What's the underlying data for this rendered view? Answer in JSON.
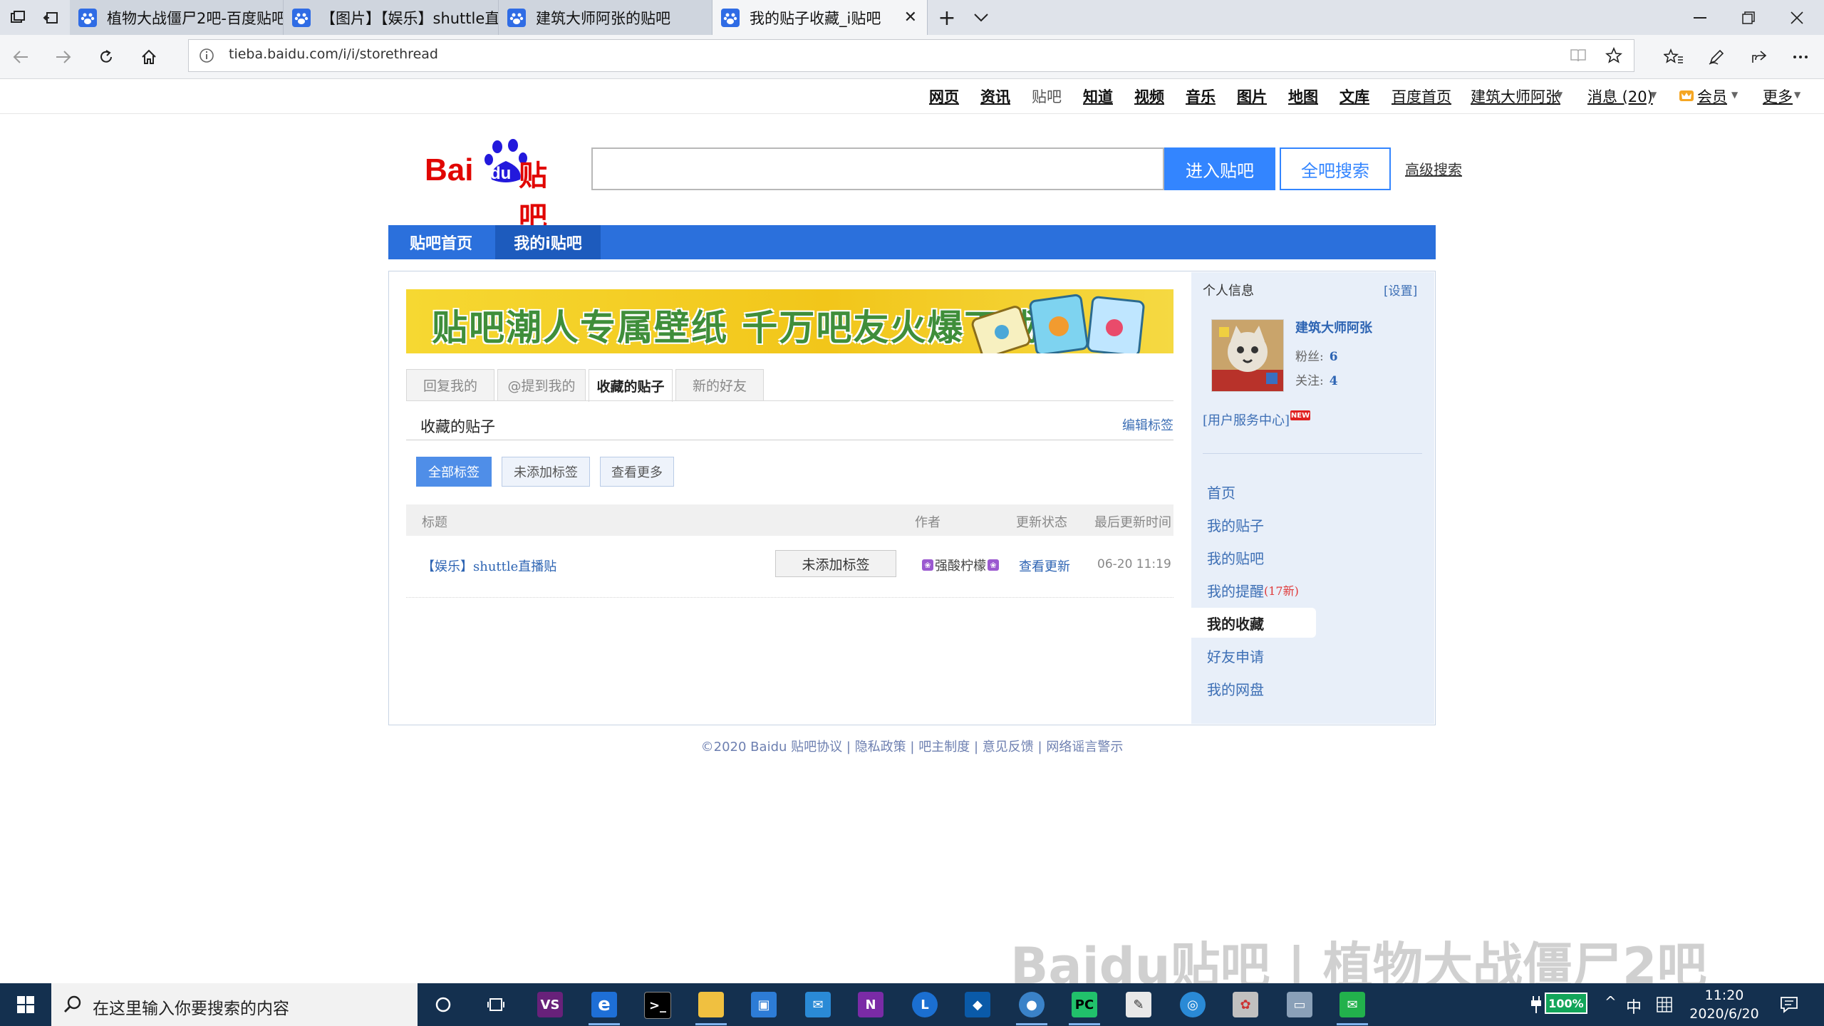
{
  "browser": {
    "tabs": [
      {
        "label": "植物大战僵尸2吧-百度贴吧:",
        "active": false
      },
      {
        "label": "【图片】【娱乐】shuttle直",
        "active": false
      },
      {
        "label": "建筑大师阿张的贴吧",
        "active": false
      },
      {
        "label": "我的贴子收藏_i贴吧",
        "active": true
      }
    ],
    "new_tab": "+",
    "tab_list": "⌄",
    "url": "tieba.baidu.com/i/i/storethread"
  },
  "top_links": {
    "web": "网页",
    "news": "资讯",
    "tieba": "贴吧",
    "zhidao": "知道",
    "video": "视频",
    "music": "音乐",
    "image": "图片",
    "map": "地图",
    "wenku": "文库",
    "baidu_home": "百度首页",
    "user": "建筑大师阿张",
    "messages": "消息 (20)",
    "vip": "会员",
    "more": "更多"
  },
  "search": {
    "logo_text_bai": "Bai",
    "logo_text_du": "du",
    "logo_text_tieba": "贴吧",
    "enter_bar": "进入贴吧",
    "search_all": "全吧搜索",
    "advanced": "高级搜索"
  },
  "nav": {
    "home": "贴吧首页",
    "my_itieba": "我的i贴吧"
  },
  "banner": {
    "text": "贴吧潮人专属壁纸 千万吧友火爆下载!"
  },
  "subtabs": [
    "回复我的",
    "@提到我的",
    "收藏的贴子",
    "新的好友"
  ],
  "section": {
    "title": "收藏的贴子",
    "edit_tags": "编辑标签"
  },
  "filters": [
    "全部标签",
    "未添加标签",
    "查看更多"
  ],
  "table": {
    "headers": {
      "title": "标题",
      "author": "作者",
      "status": "更新状态",
      "time": "最后更新时间"
    },
    "rows": [
      {
        "title": "【娱乐】shuttle直播贴",
        "tag": "未添加标签",
        "author": "强酸柠檬",
        "status": "查看更新",
        "time": "06-20 11:19"
      }
    ]
  },
  "sidebar": {
    "header": "个人信息",
    "settings": "[设置]",
    "username": "建筑大师阿张",
    "fans_label": "粉丝:",
    "fans": "6",
    "follow_label": "关注:",
    "follow": "4",
    "user_center": "[用户服务中心]",
    "new_badge": "NEW",
    "menu": {
      "home": "首页",
      "my_posts": "我的贴子",
      "my_bars": "我的贴吧",
      "reminders": "我的提醒",
      "reminders_new": "(17新)",
      "favorites": "我的收藏",
      "friend_requests": "好友申请",
      "netdisk": "我的网盘"
    }
  },
  "footer": {
    "copyright": "©2020 Baidu",
    "agreement": "贴吧协议",
    "privacy": "隐私政策",
    "rules": "吧主制度",
    "feedback": "意见反馈",
    "rumor": "网络谣言警示",
    "sep": "|"
  },
  "watermark": {
    "text": "Baidu贴吧 | 植物大战僵尸2吧"
  },
  "taskbar": {
    "search_placeholder": "在这里输入你要搜索的内容",
    "battery": "100%",
    "ime": "中",
    "time": "11:20",
    "date": "2020/6/20"
  },
  "colors": {
    "tieba_blue": "#2b70dc",
    "search_blue": "#3385ff",
    "sidebar_bg": "#e8eff9",
    "taskbar": "#14304f"
  }
}
